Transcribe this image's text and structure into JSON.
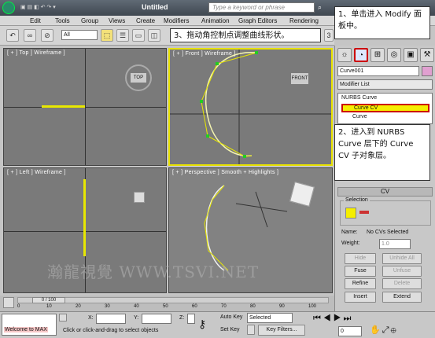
{
  "title": {
    "file": "Untitled",
    "search_placeholder": "Type a keyword or phrase"
  },
  "menu": [
    "Edit",
    "Tools",
    "Group",
    "Views",
    "Create",
    "Modifiers",
    "Animation",
    "Graph Editors",
    "Rendering"
  ],
  "toolbar": {
    "filter": "All",
    "spin_value": "3"
  },
  "viewports": {
    "top": "[ + ] Top ] Wireframe ]",
    "front": "[ + ] Front ] Wireframe ]",
    "left": "[ + ] Left ] Wireframe ]",
    "perspective": "[ + ] Perspective ] Smooth + Highlights ]",
    "front_cube": "FRONT",
    "top_cube": "TOP"
  },
  "command_panel": {
    "object_name": "Curve001",
    "modifier_list": "Modifier List",
    "stack": [
      "NURBS Curve",
      "Curve CV",
      "Curve"
    ],
    "rollout_title": "CV",
    "selection_label": "Selection",
    "name_label": "Name:",
    "name_value": "No CVs Selected",
    "weight_label": "Weight:",
    "weight_value": "1.0",
    "buttons": [
      "Hide",
      "Unhide All",
      "Fuse",
      "Unfuse",
      "Refine",
      "Delete",
      "Insert",
      "Extend"
    ]
  },
  "callouts": {
    "c1": "1、单击进入 Modify 面板中。",
    "c2": "2、进入到 NURBS Curve 层下的 Curve CV 子对象层。",
    "c3": "3、拖动角控制点调整曲线形状。"
  },
  "timeline": {
    "frame": "0 / 100",
    "ticks": [
      "0",
      "10",
      "20",
      "30",
      "40",
      "50",
      "60",
      "70",
      "80",
      "90",
      "100"
    ]
  },
  "status": {
    "welcome": "Welcome to MAX",
    "prompt": "Click or click-and-drag to select objects",
    "x_label": "X:",
    "y_label": "Y:",
    "z_label": "Z:",
    "auto_key": "Auto Key",
    "set_key": "Set Key",
    "selected": "Selected",
    "key_filters": "Key Filters...",
    "frame_value": "0"
  },
  "watermark": "瀚龍視覺 WWW.TSVI.NET",
  "colors": {
    "curve": "#e8e800",
    "cv": "#22cc22",
    "highlight": "#f5ee00",
    "callout_border": "#cc0000"
  }
}
